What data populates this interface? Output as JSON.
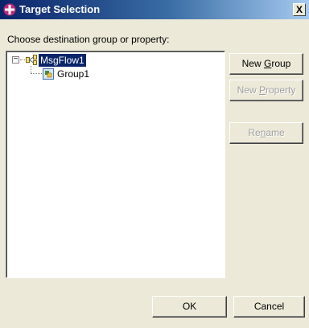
{
  "window": {
    "title": "Target Selection",
    "close_symbol": "X",
    "icon": "eclipse-cross-icon"
  },
  "prompt": "Choose destination group or property:",
  "tree": {
    "root": {
      "label": "MsgFlow1",
      "expanded": true,
      "selected": true,
      "expander_symbol": "−",
      "icon": "message-flow-icon"
    },
    "children": [
      {
        "label": "Group1",
        "icon": "group-icon"
      }
    ]
  },
  "buttons": {
    "new_group": {
      "pre": "New ",
      "mnemonic": "G",
      "post": "roup",
      "enabled": true
    },
    "new_property": {
      "pre": "New ",
      "mnemonic": "P",
      "post": "roperty",
      "enabled": false
    },
    "rename": {
      "pre": "Re",
      "mnemonic": "n",
      "post": "ame",
      "enabled": false
    },
    "ok": {
      "label": "OK",
      "enabled": true
    },
    "cancel": {
      "label": "Cancel",
      "enabled": true
    }
  },
  "colors": {
    "titlebar_start": "#0a246a",
    "titlebar_end": "#a6caf0",
    "selection": "#0a246a",
    "dialog_bg": "#ece9d8"
  }
}
